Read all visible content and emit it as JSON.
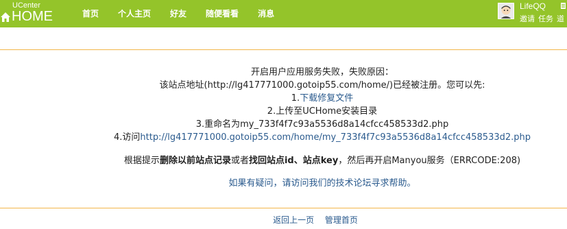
{
  "header": {
    "logo_top": "UCenter",
    "logo_main": "HOME",
    "nav": [
      "首页",
      "个人主页",
      "好友",
      "随便看看",
      "消息"
    ],
    "user": {
      "name": "LifeQQ",
      "links": [
        "邀请",
        "任务",
        "道"
      ]
    }
  },
  "message": {
    "line1": "开启用户应用服务失败，失败原因：",
    "line2": "该站点地址(http://lg417771000.gotoip55.com/home/)已经被注册。您可以先:",
    "step1_prefix": "1.",
    "step1_link": "下载修复文件",
    "step2": "2.上传至UCHome安装目录",
    "step3": "3.重命名为my_733f4f7c93a5536d8a14cfcc458533d2.php",
    "step4_prefix": "4.访问",
    "step4_link": "http://lg417771000.gotoip55.com/home/my_733f4f7c93a5536d8a14cfcc458533d2.php",
    "hint_a": "根据提示",
    "hint_b": "删除以前站点记录",
    "hint_c": "或者",
    "hint_d": "找回站点id、站点key",
    "hint_e": "，然后再开启Manyou服务（ERRCODE:208)",
    "forum_link": "如果有疑问，请访问我们的技术论坛寻求帮助。"
  },
  "footer": {
    "back": "返回上一页",
    "admin_home": "管理首页"
  },
  "colors": {
    "header_bg": "#94c42a",
    "divider": "#f2b64a",
    "link": "#2b5b8e"
  }
}
